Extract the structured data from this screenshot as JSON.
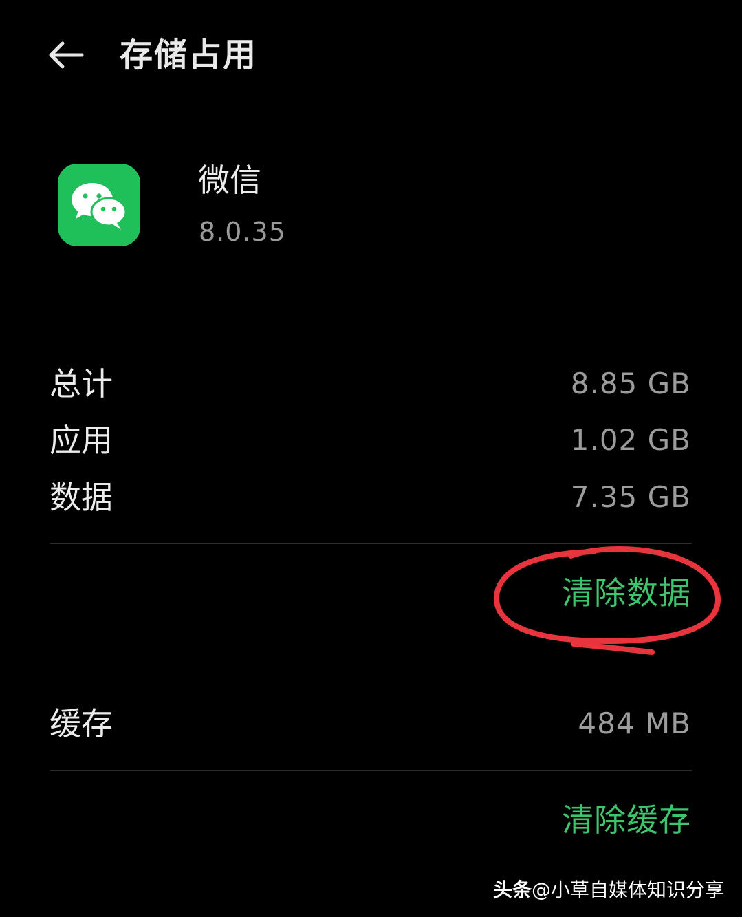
{
  "header": {
    "title": "存储占用",
    "back_icon": "back-arrow-icon"
  },
  "app": {
    "name": "微信",
    "version": "8.0.35",
    "icon": "wechat-app-icon",
    "icon_color": "#1fbf5a"
  },
  "storage": {
    "rows": [
      {
        "label": "总计",
        "value": "8.85 GB"
      },
      {
        "label": "应用",
        "value": "1.02 GB"
      },
      {
        "label": "数据",
        "value": "7.35 GB"
      }
    ],
    "clear_data_label": "清除数据"
  },
  "cache": {
    "label": "缓存",
    "value": "484 MB",
    "clear_cache_label": "清除缓存"
  },
  "annotation": {
    "color": "#e8343c",
    "target": "clear-data-button"
  },
  "watermark": {
    "brand": "头条",
    "text": "@小草自媒体知识分享"
  },
  "colors": {
    "background": "#000000",
    "accent_green": "#3ec46d",
    "primary_text": "#ececec",
    "secondary_text": "#9c9c9c"
  }
}
